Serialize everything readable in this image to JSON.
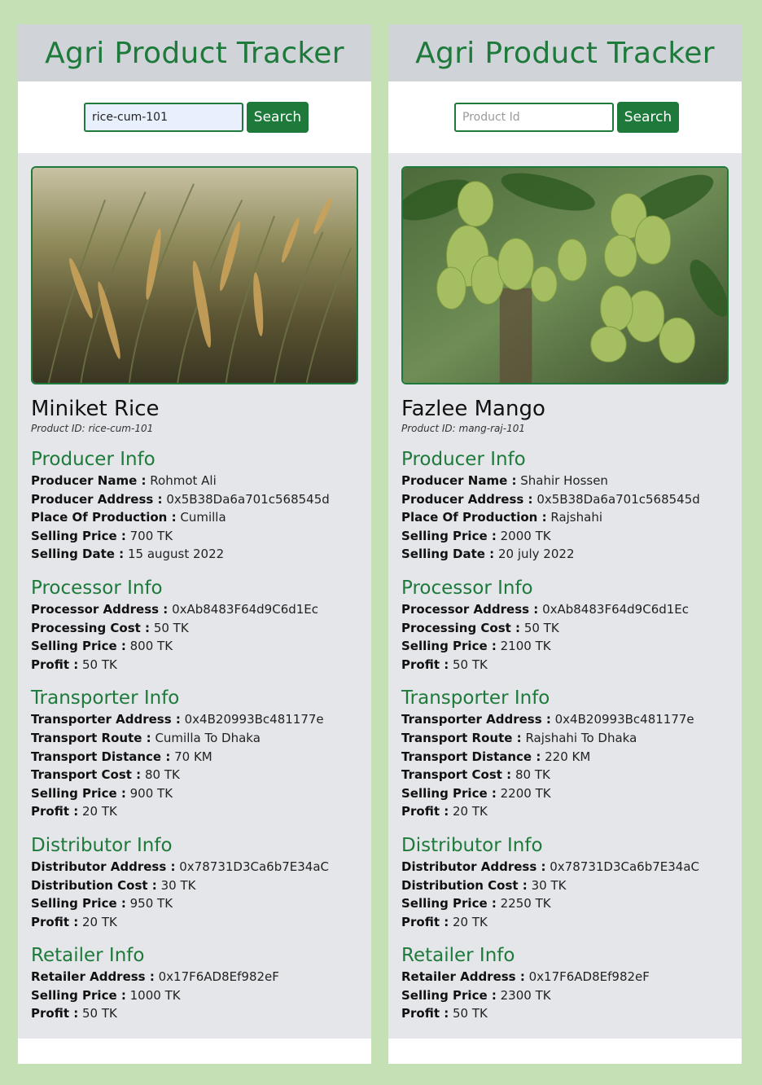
{
  "panels": [
    {
      "title": "Agri Product Tracker",
      "search": {
        "value": "rice-cum-101",
        "placeholder": "Product Id",
        "button": "Search"
      },
      "product": {
        "name": "Miniket Rice",
        "id_label": "Product ID:",
        "id": "rice-cum-101",
        "image": "rice-field-photo"
      },
      "sections": [
        {
          "title": "Producer Info",
          "rows": [
            {
              "label": "Producer Name :",
              "value": "Rohmot Ali"
            },
            {
              "label": "Producer Address :",
              "value": "0x5B38Da6a701c568545d"
            },
            {
              "label": "Place Of Production :",
              "value": "Cumilla"
            },
            {
              "label": "Selling Price :",
              "value": "700 TK"
            },
            {
              "label": "Selling Date :",
              "value": "15 august 2022"
            }
          ]
        },
        {
          "title": "Processor Info",
          "rows": [
            {
              "label": "Processor Address :",
              "value": "0xAb8483F64d9C6d1Ec"
            },
            {
              "label": "Processing Cost :",
              "value": "50 TK"
            },
            {
              "label": "Selling Price :",
              "value": "800 TK"
            },
            {
              "label": "Profit :",
              "value": "50 TK"
            }
          ]
        },
        {
          "title": "Transporter Info",
          "rows": [
            {
              "label": "Transporter Address :",
              "value": "0x4B20993Bc481177e"
            },
            {
              "label": "Transport Route :",
              "value": "Cumilla To Dhaka"
            },
            {
              "label": "Transport Distance :",
              "value": "70 KM"
            },
            {
              "label": "Transport Cost :",
              "value": "80 TK"
            },
            {
              "label": "Selling Price :",
              "value": "900 TK"
            },
            {
              "label": "Profit :",
              "value": "20 TK"
            }
          ]
        },
        {
          "title": "Distributor Info",
          "rows": [
            {
              "label": "Distributor Address :",
              "value": "0x78731D3Ca6b7E34aC"
            },
            {
              "label": "Distribution Cost :",
              "value": "30 TK"
            },
            {
              "label": "Selling Price :",
              "value": "950 TK"
            },
            {
              "label": "Profit :",
              "value": "20 TK"
            }
          ]
        },
        {
          "title": "Retailer Info",
          "rows": [
            {
              "label": "Retailer Address :",
              "value": "0x17F6AD8Ef982eF"
            },
            {
              "label": "Selling Price :",
              "value": "1000 TK"
            },
            {
              "label": "Profit :",
              "value": "50 TK"
            }
          ]
        }
      ]
    },
    {
      "title": "Agri Product Tracker",
      "search": {
        "value": "",
        "placeholder": "Product Id",
        "button": "Search"
      },
      "product": {
        "name": "Fazlee Mango",
        "id_label": "Product ID:",
        "id": "mang-raj-101",
        "image": "mango-tree-photo"
      },
      "sections": [
        {
          "title": "Producer Info",
          "rows": [
            {
              "label": "Producer Name :",
              "value": "Shahir Hossen"
            },
            {
              "label": "Producer Address :",
              "value": "0x5B38Da6a701c568545d"
            },
            {
              "label": "Place Of Production :",
              "value": "Rajshahi"
            },
            {
              "label": "Selling Price :",
              "value": "2000 TK"
            },
            {
              "label": "Selling Date :",
              "value": "20 july 2022"
            }
          ]
        },
        {
          "title": "Processor Info",
          "rows": [
            {
              "label": "Processor Address :",
              "value": "0xAb8483F64d9C6d1Ec"
            },
            {
              "label": "Processing Cost :",
              "value": "50 TK"
            },
            {
              "label": "Selling Price :",
              "value": "2100 TK"
            },
            {
              "label": "Profit :",
              "value": "50 TK"
            }
          ]
        },
        {
          "title": "Transporter Info",
          "rows": [
            {
              "label": "Transporter Address :",
              "value": "0x4B20993Bc481177e"
            },
            {
              "label": "Transport Route :",
              "value": "Rajshahi To Dhaka"
            },
            {
              "label": "Transport Distance :",
              "value": "220 KM"
            },
            {
              "label": "Transport Cost :",
              "value": "80 TK"
            },
            {
              "label": "Selling Price :",
              "value": "2200 TK"
            },
            {
              "label": "Profit :",
              "value": "20 TK"
            }
          ]
        },
        {
          "title": "Distributor Info",
          "rows": [
            {
              "label": "Distributor Address :",
              "value": "0x78731D3Ca6b7E34aC"
            },
            {
              "label": "Distribution Cost :",
              "value": "30 TK"
            },
            {
              "label": "Selling Price :",
              "value": "2250 TK"
            },
            {
              "label": "Profit :",
              "value": "20 TK"
            }
          ]
        },
        {
          "title": "Retailer Info",
          "rows": [
            {
              "label": "Retailer Address :",
              "value": "0x17F6AD8Ef982eF"
            },
            {
              "label": "Selling Price :",
              "value": "2300 TK"
            },
            {
              "label": "Profit :",
              "value": "50 TK"
            }
          ]
        }
      ]
    }
  ],
  "colors": {
    "accent": "#1d7a3a",
    "page_bg": "#c5e0b4",
    "content_bg": "#e5e6ea",
    "header_bg": "#d0d3d8"
  }
}
